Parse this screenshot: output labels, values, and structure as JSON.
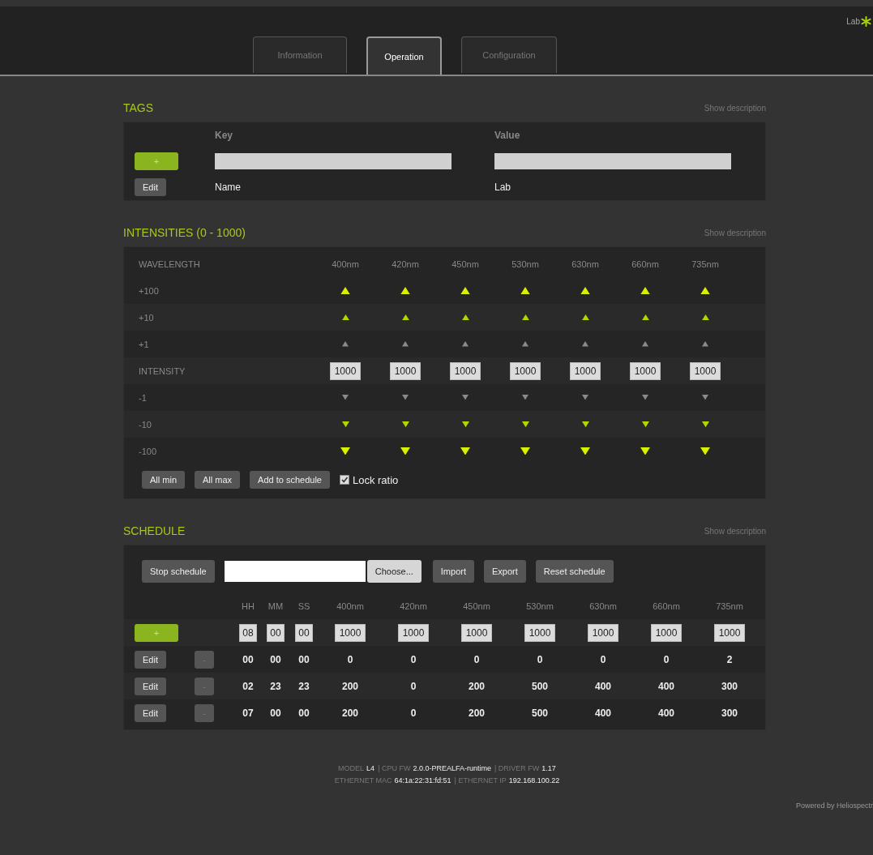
{
  "header": {
    "brand": "Lab"
  },
  "tabs": [
    {
      "label": "Information",
      "selected": false
    },
    {
      "label": "Operation",
      "selected": true
    },
    {
      "label": "Configuration",
      "selected": false
    }
  ],
  "tags": {
    "title": "TAGS",
    "description_link": "Show description",
    "columns": [
      "Key",
      "Value"
    ],
    "add_button": "+",
    "rows": [
      {
        "button": "Edit",
        "key": "Name",
        "value": "Lab"
      }
    ]
  },
  "intensities": {
    "title": "INTENSITIES (0 - 1000)",
    "description_link": "Show description",
    "header_label": "WAVELENGTH",
    "wavelengths": [
      "400nm",
      "420nm",
      "450nm",
      "530nm",
      "630nm",
      "660nm",
      "735nm"
    ],
    "rows": [
      {
        "label": "+100",
        "kind": "bigup"
      },
      {
        "label": "+10",
        "kind": "midup"
      },
      {
        "label": "+1",
        "kind": "smallup"
      },
      {
        "label": "INTENSITY",
        "kind": "field",
        "values": [
          "1000",
          "1000",
          "1000",
          "1000",
          "1000",
          "1000",
          "1000"
        ]
      },
      {
        "label": "-1",
        "kind": "smalldown"
      },
      {
        "label": "-10",
        "kind": "middown"
      },
      {
        "label": "-100",
        "kind": "bigdown"
      }
    ],
    "buttons": [
      "All min",
      "All max",
      "Add to schedule"
    ],
    "lock_ratio": {
      "label": "Lock ratio",
      "checked": true
    }
  },
  "schedule": {
    "title": "SCHEDULE",
    "description_link": "Show description",
    "toolbar": {
      "stop_button": "Stop schedule",
      "choose_button": "Choose...",
      "buttons": [
        "Import",
        "Export",
        "Reset schedule"
      ]
    },
    "columns": [
      "HH",
      "MM",
      "SS",
      "400nm",
      "420nm",
      "450nm",
      "530nm",
      "630nm",
      "660nm",
      "735nm"
    ],
    "add_button": "+",
    "new_entry": [
      "08",
      "00",
      "00",
      "1000",
      "1000",
      "1000",
      "1000",
      "1000",
      "1000",
      "1000"
    ],
    "rows": [
      {
        "edit": "Edit",
        "remove": "-",
        "cells": [
          "00",
          "00",
          "00",
          "0",
          "0",
          "0",
          "0",
          "0",
          "0",
          "2"
        ]
      },
      {
        "edit": "Edit",
        "remove": "-",
        "cells": [
          "02",
          "23",
          "23",
          "200",
          "0",
          "200",
          "500",
          "400",
          "400",
          "300"
        ]
      },
      {
        "edit": "Edit",
        "remove": "-",
        "cells": [
          "07",
          "00",
          "00",
          "200",
          "0",
          "200",
          "500",
          "400",
          "400",
          "300"
        ]
      }
    ]
  },
  "footer": {
    "lines": [
      [
        {
          "label": "MODEL",
          "value": "L4"
        },
        {
          "label": "| CPU FW",
          "value": "2.0.0-PREALFA-runtime"
        },
        {
          "label": "| DRIVER FW",
          "value": "1.17"
        }
      ],
      [
        {
          "label": "ETHERNET MAC",
          "value": "64:1a:22:31:fd:51"
        },
        {
          "label": "| ETHERNET IP",
          "value": "192.168.100.22"
        }
      ]
    ],
    "powered": "Powered by Heliospectr"
  }
}
